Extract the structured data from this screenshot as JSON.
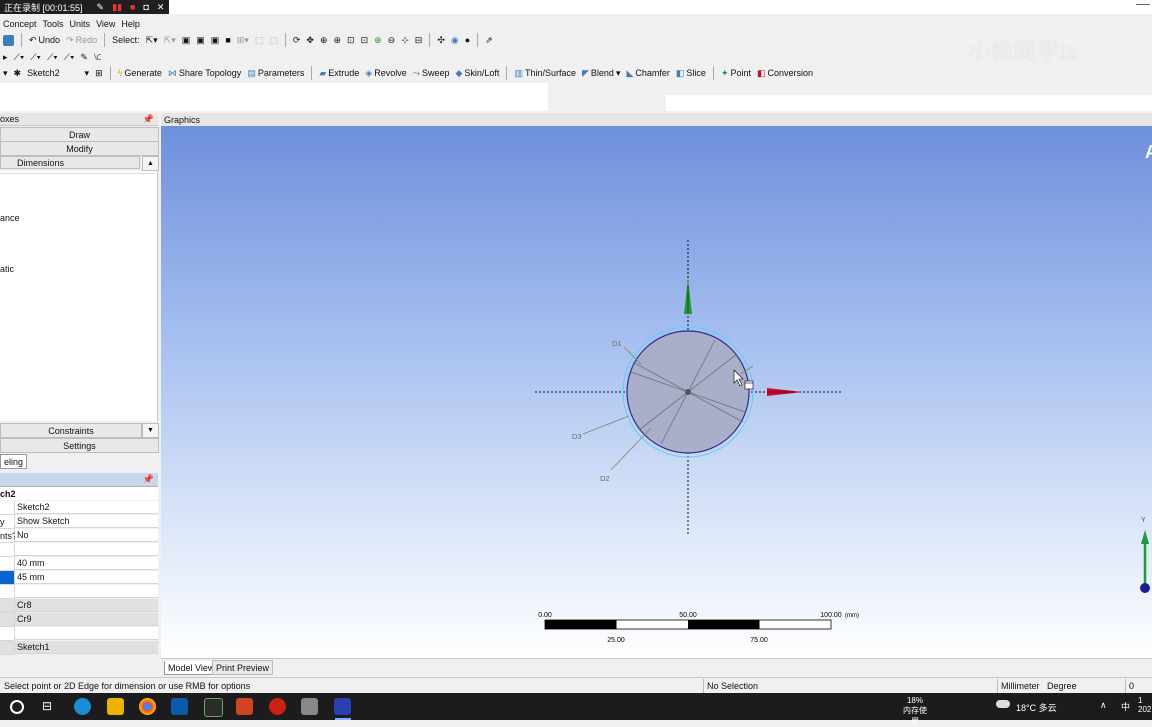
{
  "recording": {
    "text": "正在录制 [00:01:55]"
  },
  "watermark": "小徐同学ls",
  "menu": [
    "Concept",
    "Tools",
    "Units",
    "View",
    "Help"
  ],
  "toolbar1": {
    "undo": "Undo",
    "redo": "Redo",
    "select": "Select:"
  },
  "toolbar3": {
    "sketch_select": "Sketch2",
    "generate": "Generate",
    "share_topology": "Share Topology",
    "parameters": "Parameters",
    "extrude": "Extrude",
    "revolve": "Revolve",
    "sweep": "Sweep",
    "skin_loft": "Skin/Loft",
    "thin_surface": "Thin/Surface",
    "blend": "Blend",
    "chamfer": "Chamfer",
    "slice": "Slice",
    "point": "Point",
    "conversion": "Conversion"
  },
  "sketch_panel": {
    "title": "oxes",
    "draw": "Draw",
    "modify": "Modify",
    "dimensions": "Dimensions",
    "items": [
      "ance",
      "atic"
    ],
    "constraints": "Constraints",
    "settings": "Settings",
    "tab": "eling"
  },
  "details": {
    "header": "ch2",
    "rows": [
      {
        "label": "",
        "value": "Sketch2",
        "shade": false
      },
      {
        "label": "y",
        "value": "Show Sketch",
        "shade": false
      },
      {
        "label": "nts?",
        "value": "No",
        "shade": false
      },
      {
        "label": "",
        "value": "",
        "shade": false
      },
      {
        "label": "",
        "value": "40 mm",
        "shade": false
      },
      {
        "label": "",
        "value": "45 mm",
        "shade": false,
        "selected": true
      },
      {
        "label": "",
        "value": "",
        "shade": false
      },
      {
        "label": "",
        "value": "Cr8",
        "shade": true
      },
      {
        "label": "",
        "value": "Cr9",
        "shade": true
      },
      {
        "label": "",
        "value": "",
        "shade": false
      },
      {
        "label": "",
        "value": "Sketch1",
        "shade": true
      }
    ]
  },
  "graphics": {
    "title": "Graphics",
    "dim_labels": {
      "d1": "D1",
      "d2": "D2",
      "d3": "D3"
    },
    "scale": {
      "t0": "0.00",
      "t50": "50.00",
      "t100": "100.00",
      "unit": "(mm)",
      "t25": "25.00",
      "t75": "75.00"
    },
    "triad_y": "Y",
    "corner_glyph": "A"
  },
  "view_tabs": [
    "Model View",
    "Print Preview"
  ],
  "status": {
    "message": "Select point or 2D Edge for dimension or use RMB for options",
    "selection": "No Selection",
    "length_unit": "Millimeter",
    "angle_unit": "Degree",
    "value": "0"
  },
  "taskbar": {
    "mem_pct": "18%",
    "mem_label": "内存使用",
    "weather": "18°C 多云",
    "ime": "中",
    "clock_top": "1",
    "clock_bottom": "202"
  },
  "colors": {
    "accent_red": "#c8102e",
    "accent_green": "#1f9a3a",
    "circle_fill": "#a9afc9",
    "circle_stroke": "#2b2a8c"
  }
}
